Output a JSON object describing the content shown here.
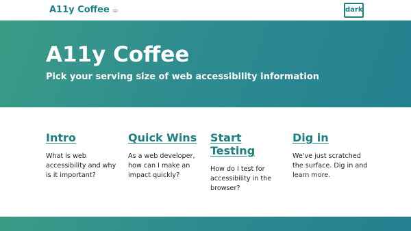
{
  "header": {
    "brand": "A11y Coffee",
    "brand_icon": "☕",
    "theme_toggle": "dark"
  },
  "hero": {
    "title": "A11y Coffee",
    "subtitle": "Pick your serving size of web accessibility information"
  },
  "cards": [
    {
      "title": "Intro",
      "text": "What is web accessibility and why is it important?"
    },
    {
      "title": "Quick Wins",
      "text": "As a web developer, how can I make an impact quickly?"
    },
    {
      "title": "Start Testing",
      "text": "How do I test for accessibility in the browser?"
    },
    {
      "title": "Dig in",
      "text": "We've just scratched the surface. Dig in and learn more."
    }
  ],
  "colors": {
    "accent": "#1e7f7f",
    "hero_gradient_start": "#3b9c86",
    "hero_gradient_end": "#24808f"
  }
}
